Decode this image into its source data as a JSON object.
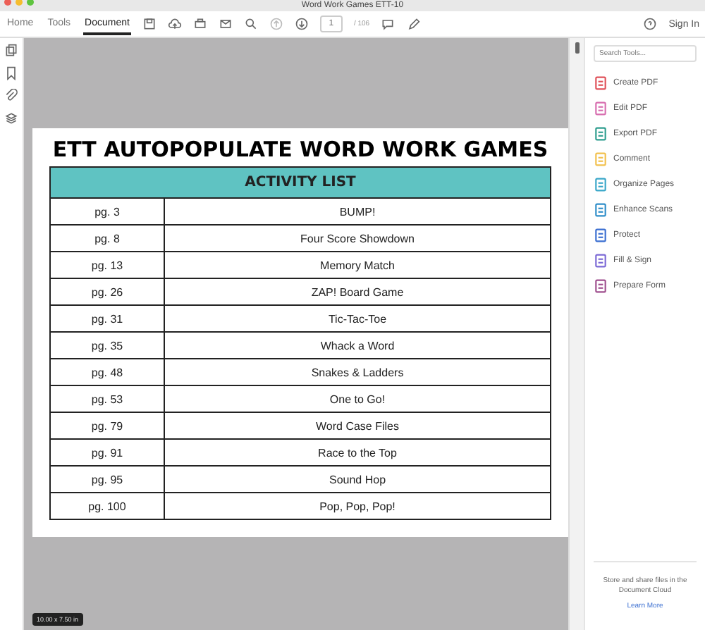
{
  "window": {
    "title": "Word Work Games ETT-10"
  },
  "tabs": [
    {
      "label": "Home",
      "selected": false
    },
    {
      "label": "Tools",
      "selected": false
    },
    {
      "label": "Document",
      "selected": true
    }
  ],
  "page_field": {
    "value": "1",
    "total": "/ 106"
  },
  "sign_in": "Sign In",
  "document": {
    "title": "ETT AUTOPOPULATE WORD WORK GAMES",
    "table_header": "ACTIVITY LIST",
    "rows": [
      {
        "page": "pg. 3",
        "activity": "BUMP!"
      },
      {
        "page": "pg. 8",
        "activity": "Four Score Showdown"
      },
      {
        "page": "pg. 13",
        "activity": "Memory Match"
      },
      {
        "page": "pg. 26",
        "activity": "ZAP! Board Game"
      },
      {
        "page": "pg. 31",
        "activity": "Tic-Tac-Toe"
      },
      {
        "page": "pg. 35",
        "activity": "Whack a Word"
      },
      {
        "page": "pg. 48",
        "activity": "Snakes & Ladders"
      },
      {
        "page": "pg. 53",
        "activity": "One to Go!"
      },
      {
        "page": "pg. 79",
        "activity": "Word Case Files"
      },
      {
        "page": "pg. 91",
        "activity": "Race to the Top"
      },
      {
        "page": "pg. 95",
        "activity": "Sound Hop"
      },
      {
        "page": "pg. 100",
        "activity": "Pop, Pop, Pop!"
      }
    ]
  },
  "page_size": "10.00 x 7.50 in",
  "tools_panel": {
    "search": {
      "placeholder": "Search Tools..."
    },
    "tools": [
      {
        "label": "Create PDF",
        "color": "#e0525a"
      },
      {
        "label": "Edit PDF",
        "color": "#d86fb0"
      },
      {
        "label": "Export PDF",
        "color": "#2f9e8f"
      },
      {
        "label": "Comment",
        "color": "#f2c14e"
      },
      {
        "label": "Organize Pages",
        "color": "#3aa7c9"
      },
      {
        "label": "Enhance Scans",
        "color": "#2f8ec9"
      },
      {
        "label": "Protect",
        "color": "#3b6fd1"
      },
      {
        "label": "Fill & Sign",
        "color": "#7c6ad6"
      },
      {
        "label": "Prepare Form",
        "color": "#a0508f"
      }
    ],
    "cloud_text": "Store and share files in the Document Cloud",
    "learn_more": "Learn More"
  }
}
